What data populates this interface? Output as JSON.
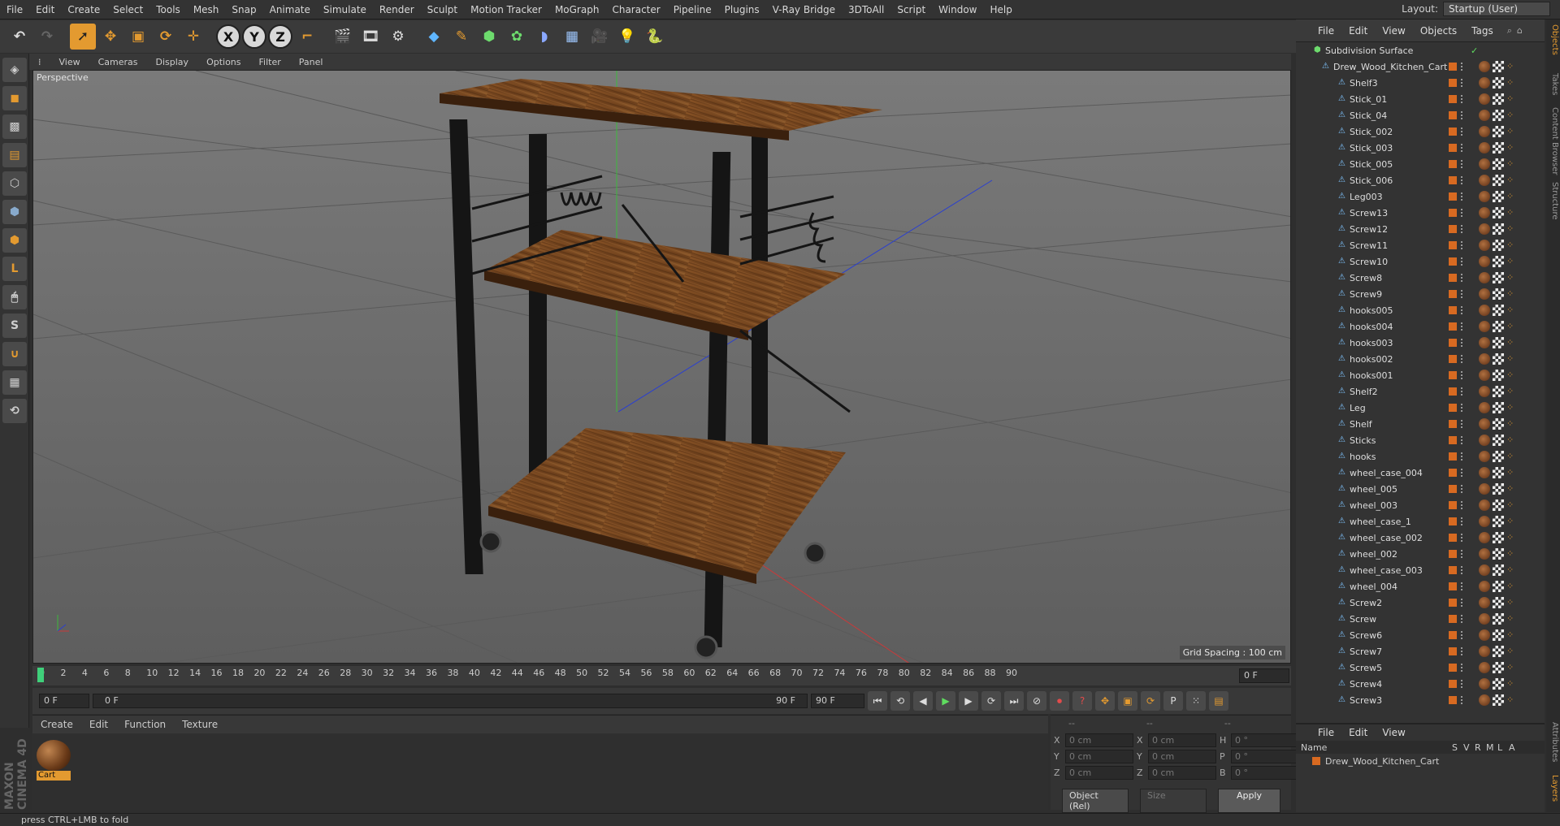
{
  "menu": [
    "File",
    "Edit",
    "Create",
    "Select",
    "Tools",
    "Mesh",
    "Snap",
    "Animate",
    "Simulate",
    "Render",
    "Sculpt",
    "Motion Tracker",
    "MoGraph",
    "Character",
    "Pipeline",
    "Plugins",
    "V-Ray Bridge",
    "3DToAll",
    "Script",
    "Window",
    "Help"
  ],
  "layout": {
    "label": "Layout:",
    "value": "Startup (User)"
  },
  "toolbar_axes": [
    "X",
    "Y",
    "Z"
  ],
  "viewport": {
    "menu": [
      "View",
      "Cameras",
      "Display",
      "Options",
      "Filter",
      "Panel"
    ],
    "label": "Perspective",
    "grid_spacing": "Grid Spacing : 100 cm"
  },
  "timeline": {
    "ticks": [
      "0",
      "2",
      "4",
      "6",
      "8",
      "10",
      "12",
      "14",
      "16",
      "18",
      "20",
      "22",
      "24",
      "26",
      "28",
      "30",
      "32",
      "34",
      "36",
      "38",
      "40",
      "42",
      "44",
      "46",
      "48",
      "50",
      "52",
      "54",
      "56",
      "58",
      "60",
      "62",
      "64",
      "66",
      "68",
      "70",
      "72",
      "74",
      "76",
      "78",
      "80",
      "82",
      "84",
      "86",
      "88",
      "90"
    ],
    "frame_end_field": "0 F"
  },
  "transport": {
    "current": "0 F",
    "range_start": "0 F",
    "range_end": "90 F",
    "end_field": "90 F"
  },
  "materials": {
    "menu": [
      "Create",
      "Edit",
      "Function",
      "Texture"
    ],
    "items": [
      {
        "name": "Cart"
      }
    ]
  },
  "coords": {
    "rows": [
      {
        "a": "X",
        "av": "0 cm",
        "b": "X",
        "bv": "0 cm",
        "c": "H",
        "cv": "0 °"
      },
      {
        "a": "Y",
        "av": "0 cm",
        "b": "Y",
        "bv": "0 cm",
        "c": "P",
        "cv": "0 °"
      },
      {
        "a": "Z",
        "av": "0 cm",
        "b": "Z",
        "bv": "0 cm",
        "c": "B",
        "cv": "0 °"
      }
    ],
    "mode": "Object (Rel)",
    "size": "Size",
    "apply": "Apply",
    "headers": [
      "--",
      "--",
      "--"
    ]
  },
  "objects": {
    "menu": [
      "File",
      "Edit",
      "View",
      "Objects",
      "Tags"
    ],
    "root": "Subdivision Surface",
    "group": "Drew_Wood_Kitchen_Cart",
    "children": [
      "Shelf3",
      "Stick_01",
      "Stick_04",
      "Stick_002",
      "Stick_003",
      "Stick_005",
      "Stick_006",
      "Leg003",
      "Screw13",
      "Screw12",
      "Screw11",
      "Screw10",
      "Screw8",
      "Screw9",
      "hooks005",
      "hooks004",
      "hooks003",
      "hooks002",
      "hooks001",
      "Shelf2",
      "Leg",
      "Shelf",
      "Sticks",
      "hooks",
      "wheel_case_004",
      "wheel_005",
      "wheel_003",
      "wheel_case_1",
      "wheel_case_002",
      "wheel_002",
      "wheel_case_003",
      "wheel_004",
      "Screw2",
      "Screw",
      "Screw6",
      "Screw7",
      "Screw5",
      "Screw4",
      "Screw3"
    ]
  },
  "layers": {
    "menu": [
      "File",
      "Edit",
      "View"
    ],
    "headers": [
      "Name",
      "S",
      "V",
      "R",
      "M",
      "L",
      "A"
    ],
    "rows": [
      "Drew_Wood_Kitchen_Cart"
    ]
  },
  "side_tabs": [
    "Objects",
    "Takes",
    "Content Browser",
    "Structure",
    "Attributes",
    "Layers"
  ],
  "status": "press CTRL+LMB to fold",
  "brand": "MAXON CINEMA 4D",
  "colors": {
    "accent": "#e39a30",
    "wood": "#7a4a22",
    "metal": "#151515",
    "viewport_bg": "#6f6f6f"
  }
}
